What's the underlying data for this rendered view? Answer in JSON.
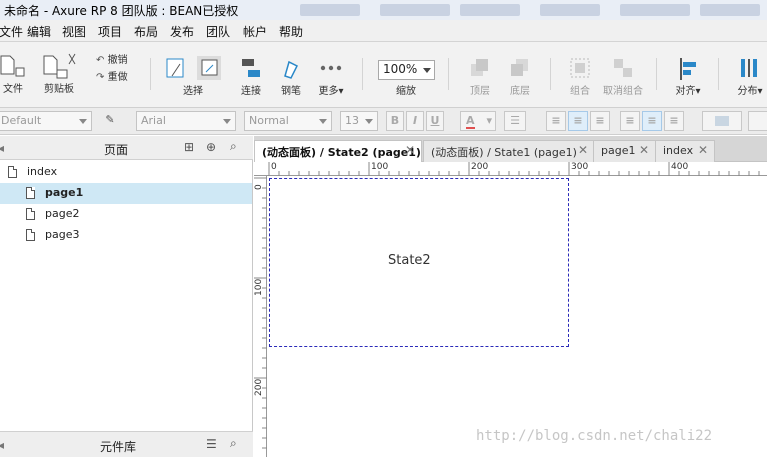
{
  "window": {
    "title": "未命名 - Axure RP 8 团队版 : BEAN已授权"
  },
  "menu": [
    "文件",
    "编辑",
    "视图",
    "项目",
    "布局",
    "发布",
    "团队",
    "帐户",
    "帮助"
  ],
  "toolbar": {
    "file_label": "文件",
    "clipboard_label": "剪贴板",
    "undo_label": "撤销",
    "redo_label": "重做",
    "select_label": "选择",
    "connect_label": "连接",
    "pen_label": "钢笔",
    "more_label": "更多",
    "zoom_value": "100%",
    "zoom_label": "缩放",
    "top_label": "顶层",
    "bottom_label": "底层",
    "group_label": "组合",
    "ungroup_label": "取消组合",
    "align_label": "对齐",
    "distribute_label": "分布"
  },
  "format": {
    "style": "Default",
    "font": "Arial",
    "weight": "Normal",
    "size": "13",
    "bold": "B",
    "italic": "I",
    "underline": "U",
    "font_color": "A"
  },
  "pages_panel": {
    "title": "页面",
    "items": [
      {
        "label": "index",
        "level": 0
      },
      {
        "label": "page1",
        "level": 1,
        "selected": true
      },
      {
        "label": "page2",
        "level": 1
      },
      {
        "label": "page3",
        "level": 1
      }
    ]
  },
  "widgets_panel": {
    "title": "元件库"
  },
  "tabs": [
    {
      "label": "(动态面板) / State2 (page1)",
      "active": true
    },
    {
      "label": "(动态面板) / State1 (page1)"
    },
    {
      "label": "page1"
    },
    {
      "label": "index"
    }
  ],
  "ruler": {
    "h_ticks": [
      "0",
      "100",
      "200",
      "300",
      "400"
    ],
    "v_ticks": [
      "0",
      "100",
      "200"
    ]
  },
  "canvas": {
    "state_label": "State2"
  },
  "watermark": "http://blog.csdn.net/chali22",
  "colors": {
    "selection": "#cfe8f5",
    "panel_border": "#2a2ab8",
    "accent_blue": "#2b88c8"
  }
}
